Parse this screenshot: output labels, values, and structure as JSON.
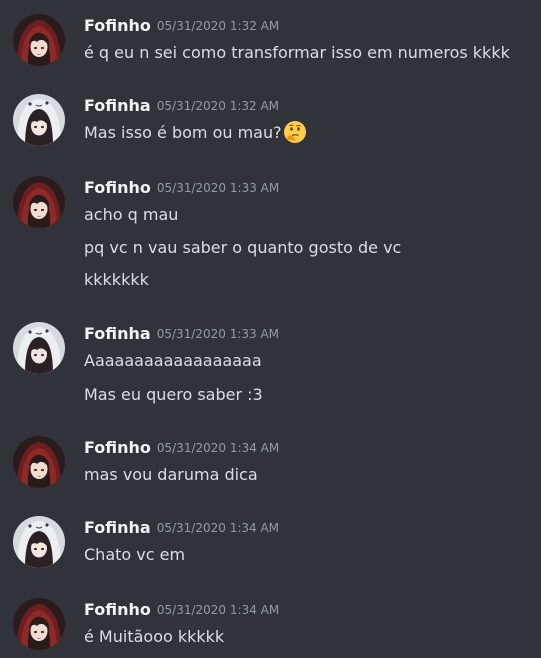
{
  "colors": {
    "background": "#313338",
    "username": "#f2f3f5",
    "timestamp": "#949ba4",
    "message_text": "#dbdee1"
  },
  "messages": [
    {
      "author": "Fofinho",
      "avatar_icon": "red-hood-girl-avatar-icon",
      "timestamp": "05/31/2020 1:32 AM",
      "lines": [
        "é q eu n sei como transformar isso em numeros kkkk"
      ]
    },
    {
      "author": "Fofinha",
      "avatar_icon": "ghost-hood-girl-avatar-icon",
      "timestamp": "05/31/2020 1:32 AM",
      "lines": [
        "Mas isso é bom ou mau?"
      ],
      "emoji": "thinking-face-emoji-icon"
    },
    {
      "author": "Fofinho",
      "avatar_icon": "red-hood-girl-avatar-icon",
      "timestamp": "05/31/2020 1:33 AM",
      "lines": [
        "acho q mau",
        "pq vc n vau saber o quanto gosto de vc",
        "kkkkkkk"
      ]
    },
    {
      "author": "Fofinha",
      "avatar_icon": "ghost-hood-girl-avatar-icon",
      "timestamp": "05/31/2020 1:33 AM",
      "lines": [
        "Aaaaaaaaaaaaaaaaaa",
        "Mas eu quero saber :3"
      ]
    },
    {
      "author": "Fofinho",
      "avatar_icon": "red-hood-girl-avatar-icon",
      "timestamp": "05/31/2020 1:34 AM",
      "lines": [
        "mas vou daruma dica"
      ]
    },
    {
      "author": "Fofinha",
      "avatar_icon": "ghost-hood-girl-avatar-icon",
      "timestamp": "05/31/2020 1:34 AM",
      "lines": [
        "Chato vc em"
      ]
    },
    {
      "author": "Fofinho",
      "avatar_icon": "red-hood-girl-avatar-icon",
      "timestamp": "05/31/2020 1:34 AM",
      "lines": [
        "é Muitãooo kkkkk"
      ]
    }
  ]
}
